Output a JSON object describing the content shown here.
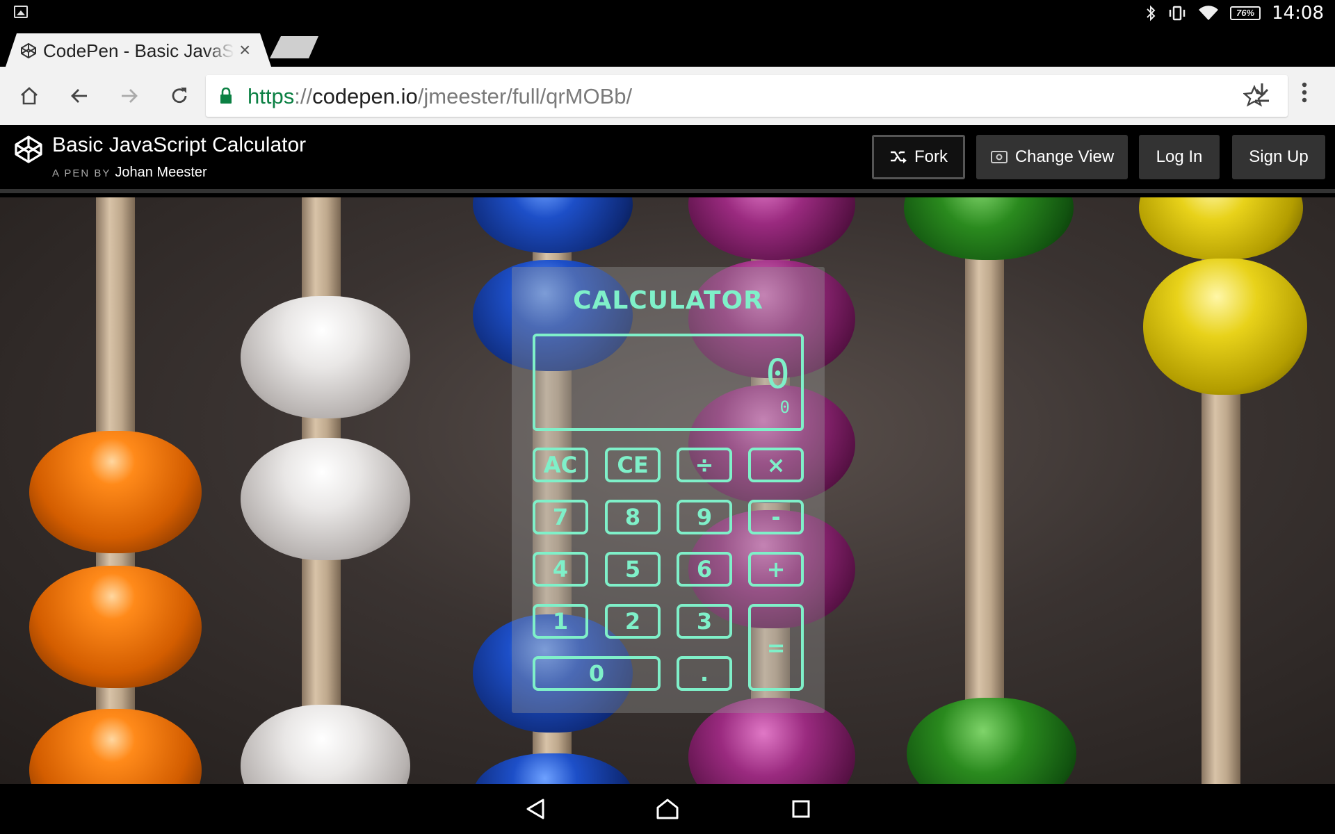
{
  "status_bar": {
    "time": "14:08",
    "battery": "76%",
    "icons": [
      "picture-icon",
      "bluetooth-icon",
      "vibrate-icon",
      "wifi-icon",
      "battery-icon"
    ]
  },
  "browser": {
    "tab_title": "CodePen - Basic JavaScript Calculator",
    "tab_close": "×",
    "url": {
      "scheme": "https",
      "separator": "://",
      "host": "codepen.io",
      "path": "/jmeester/full/qrMOBb/"
    }
  },
  "codepen_header": {
    "title": "Basic JavaScript Calculator",
    "byline_prefix": "A PEN BY",
    "author": "Johan Meester",
    "buttons": {
      "fork": "Fork",
      "change_view": "Change View",
      "login": "Log In",
      "signup": "Sign Up"
    }
  },
  "calculator": {
    "title": "CALCULATOR",
    "display": "0",
    "history": "0",
    "keys": {
      "ac": "AC",
      "ce": "CE",
      "divide": "÷",
      "multiply": "×",
      "seven": "7",
      "eight": "8",
      "nine": "9",
      "minus": "-",
      "four": "4",
      "five": "5",
      "six": "6",
      "plus": "+",
      "one": "1",
      "two": "2",
      "three": "3",
      "equals": "=",
      "zero": "0",
      "decimal": "."
    },
    "accent_color": "#7ff0c9"
  },
  "colors": {
    "url_scheme": "#0b8043",
    "toolbar_bg": "#f2f2f2",
    "codepen_header_bg": "#000000"
  }
}
